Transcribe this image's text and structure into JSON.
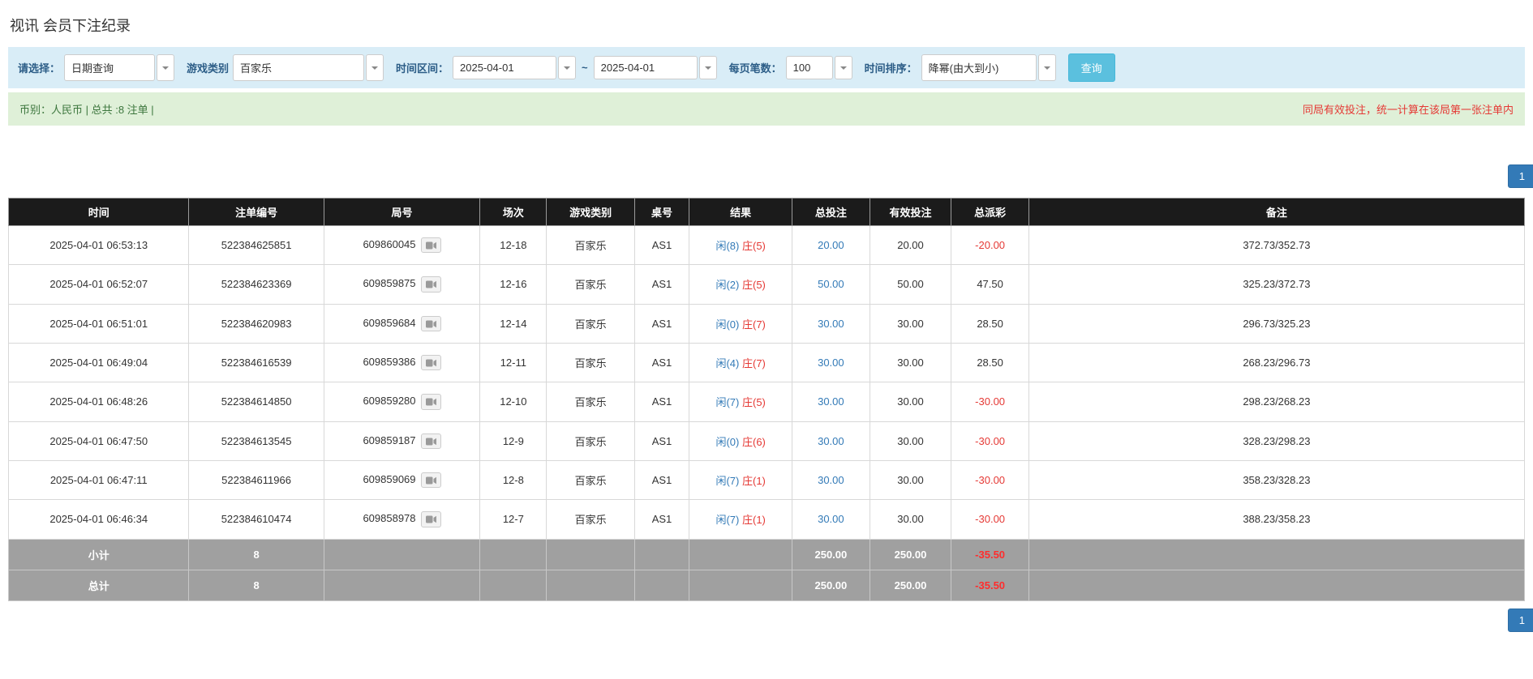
{
  "page": {
    "title": "视讯 会员下注纪录"
  },
  "colors": {
    "filter_bar_bg": "#d9edf7",
    "summary_bar_bg": "#dff0d8",
    "summary_text_green": "#3c763d",
    "warning_red": "#e53935",
    "link_blue": "#337ab7",
    "search_button_teal": "#5bc0de",
    "table_header_bg": "#1b1b1b",
    "table_footer_gray": "#a0a0a0"
  },
  "filters": {
    "select_label": "请选择：",
    "select_value": "日期查询",
    "game_type_label": "游戏类别",
    "game_type_value": "百家乐",
    "date_range_label": "时间区间：",
    "date_from": "2025-04-01",
    "date_separator": "~",
    "date_to": "2025-04-01",
    "page_size_label": "每页笔数：",
    "page_size_value": "100",
    "sort_label": "时间排序：",
    "sort_value": "降幂(由大到小)",
    "search_button": "查询"
  },
  "summary": {
    "left": "币别：人民币 | 总共 :8 注单 |",
    "right": "同局有效投注，统一计算在该局第一张注单内"
  },
  "pagination": {
    "page": "1"
  },
  "table": {
    "headers": [
      "时间",
      "注单编号",
      "局号",
      "场次",
      "游戏类别",
      "桌号",
      "结果",
      "总投注",
      "有效投注",
      "总派彩",
      "备注"
    ],
    "rows": [
      {
        "time": "2025-04-01 06:53:13",
        "bet_id": "522384625851",
        "round_id": "609860045",
        "session": "12-18",
        "game": "百家乐",
        "table_no": "AS1",
        "result_player": "闲(8)",
        "result_banker": "庄(5)",
        "total_bet": "20.00",
        "valid_bet": "20.00",
        "payout": "-20.00",
        "remark": "372.73/352.73"
      },
      {
        "time": "2025-04-01 06:52:07",
        "bet_id": "522384623369",
        "round_id": "609859875",
        "session": "12-16",
        "game": "百家乐",
        "table_no": "AS1",
        "result_player": "闲(2)",
        "result_banker": "庄(5)",
        "total_bet": "50.00",
        "valid_bet": "50.00",
        "payout": "47.50",
        "remark": "325.23/372.73"
      },
      {
        "time": "2025-04-01 06:51:01",
        "bet_id": "522384620983",
        "round_id": "609859684",
        "session": "12-14",
        "game": "百家乐",
        "table_no": "AS1",
        "result_player": "闲(0)",
        "result_banker": "庄(7)",
        "total_bet": "30.00",
        "valid_bet": "30.00",
        "payout": "28.50",
        "remark": "296.73/325.23"
      },
      {
        "time": "2025-04-01 06:49:04",
        "bet_id": "522384616539",
        "round_id": "609859386",
        "session": "12-11",
        "game": "百家乐",
        "table_no": "AS1",
        "result_player": "闲(4)",
        "result_banker": "庄(7)",
        "total_bet": "30.00",
        "valid_bet": "30.00",
        "payout": "28.50",
        "remark": "268.23/296.73"
      },
      {
        "time": "2025-04-01 06:48:26",
        "bet_id": "522384614850",
        "round_id": "609859280",
        "session": "12-10",
        "game": "百家乐",
        "table_no": "AS1",
        "result_player": "闲(7)",
        "result_banker": "庄(5)",
        "total_bet": "30.00",
        "valid_bet": "30.00",
        "payout": "-30.00",
        "remark": "298.23/268.23"
      },
      {
        "time": "2025-04-01 06:47:50",
        "bet_id": "522384613545",
        "round_id": "609859187",
        "session": "12-9",
        "game": "百家乐",
        "table_no": "AS1",
        "result_player": "闲(0)",
        "result_banker": "庄(6)",
        "total_bet": "30.00",
        "valid_bet": "30.00",
        "payout": "-30.00",
        "remark": "328.23/298.23"
      },
      {
        "time": "2025-04-01 06:47:11",
        "bet_id": "522384611966",
        "round_id": "609859069",
        "session": "12-8",
        "game": "百家乐",
        "table_no": "AS1",
        "result_player": "闲(7)",
        "result_banker": "庄(1)",
        "total_bet": "30.00",
        "valid_bet": "30.00",
        "payout": "-30.00",
        "remark": "358.23/328.23"
      },
      {
        "time": "2025-04-01 06:46:34",
        "bet_id": "522384610474",
        "round_id": "609858978",
        "session": "12-7",
        "game": "百家乐",
        "table_no": "AS1",
        "result_player": "闲(7)",
        "result_banker": "庄(1)",
        "total_bet": "30.00",
        "valid_bet": "30.00",
        "payout": "-30.00",
        "remark": "388.23/358.23"
      }
    ],
    "subtotal": {
      "label": "小计",
      "count": "8",
      "total_bet": "250.00",
      "valid_bet": "250.00",
      "payout": "-35.50"
    },
    "total": {
      "label": "总计",
      "count": "8",
      "total_bet": "250.00",
      "valid_bet": "250.00",
      "payout": "-35.50"
    }
  }
}
